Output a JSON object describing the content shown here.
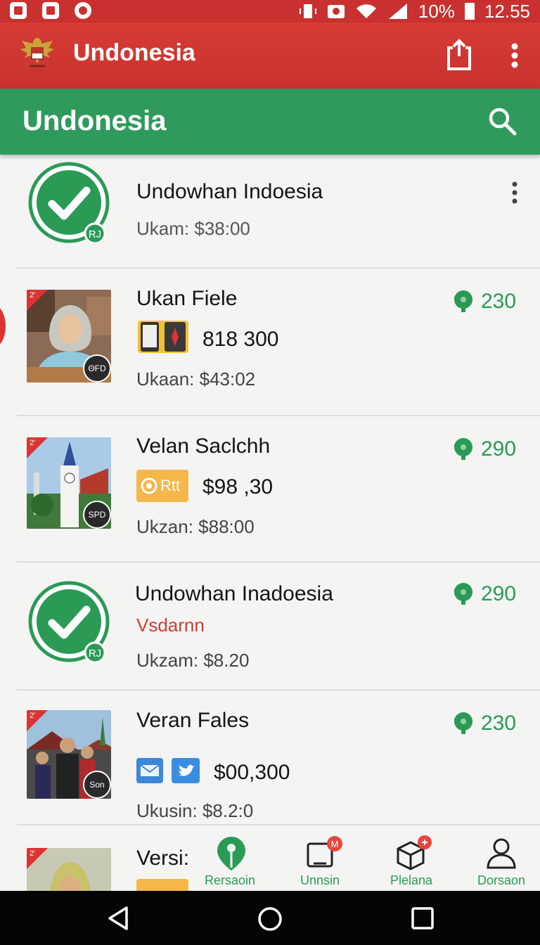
{
  "status_bar": {
    "battery": "10%",
    "time": "12.55"
  },
  "app_bar": {
    "title": "Undonesia"
  },
  "green_bar": {
    "title": "Undonesia"
  },
  "list": [
    {
      "type": "check",
      "title": "Undowhan Indoesia",
      "badge": "RJ",
      "subtitle": "Ukam: $38:00"
    },
    {
      "type": "photo",
      "title": "Ukan Fiele",
      "badge": "ΘFD",
      "amount": "818 300",
      "subtitle": "Ukaan: $43:02",
      "score": "230"
    },
    {
      "type": "photo",
      "title": "Velan Saclchh",
      "badge": "SPD",
      "chip": "Rtt",
      "amount": "$98 ,30",
      "subtitle": "Ukzan: $88:00",
      "score": "290"
    },
    {
      "type": "check",
      "title": "Undowhan Inadoesia",
      "badge": "RJ",
      "tag": "Vsdarnn",
      "subtitle": "Ukzam:  $8.20",
      "score": "290"
    },
    {
      "type": "photo",
      "title": "Veran Fales",
      "badge": "Son",
      "amount": "$00,300",
      "subtitle": "Ukusin:  $8.2:0",
      "score": "230"
    },
    {
      "type": "photo",
      "title": "Versi:"
    }
  ],
  "bottom_nav": [
    {
      "label": "Rersaoin",
      "color": "#2a9a55"
    },
    {
      "label": "Unnsin",
      "badge": "M",
      "color": "#2a9a55"
    },
    {
      "label": "Plelana",
      "color": "#2a9a55"
    },
    {
      "label": "Dorsaon",
      "color": "#2a9a55"
    }
  ],
  "colors": {
    "app_bar": "#c93230",
    "green_bar": "#2f9a5c",
    "score": "#2a9a55",
    "tag_red": "#d23c30"
  }
}
